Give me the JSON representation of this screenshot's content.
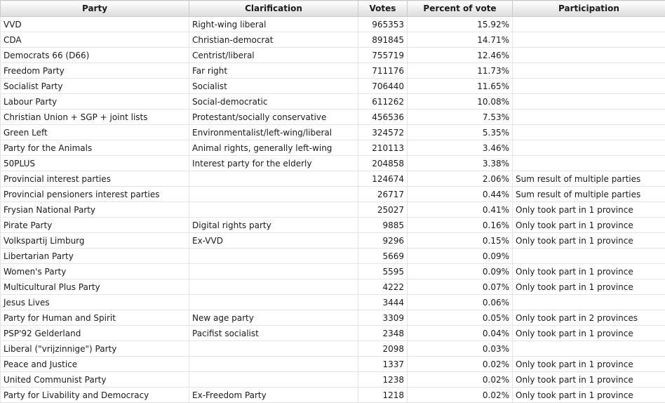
{
  "headers": [
    "Party",
    "Clarification",
    "Votes",
    "Percent of vote",
    "Participation"
  ],
  "rows": [
    [
      "VVD",
      "Right-wing liberal",
      "965353",
      "15.92%",
      ""
    ],
    [
      "CDA",
      "Christian-democrat",
      "891845",
      "14.71%",
      ""
    ],
    [
      "Democrats 66 (D66)",
      "Centrist/liberal",
      "755719",
      "12.46%",
      ""
    ],
    [
      "Freedom Party",
      "Far right",
      "711176",
      "11.73%",
      ""
    ],
    [
      "Socialist Party",
      "Socialist",
      "706440",
      "11.65%",
      ""
    ],
    [
      "Labour Party",
      "Social-democratic",
      "611262",
      "10.08%",
      ""
    ],
    [
      "Christian Union + SGP + joint lists",
      "Protestant/socially conservative",
      "456536",
      "7.53%",
      ""
    ],
    [
      "Green Left",
      "Environmentalist/left-wing/liberal",
      "324572",
      "5.35%",
      ""
    ],
    [
      "Party for the Animals",
      "Animal rights, generally left-wing",
      "210113",
      "3.46%",
      ""
    ],
    [
      "50PLUS",
      "Interest party for the elderly",
      "204858",
      "3.38%",
      ""
    ],
    [
      "Provincial interest parties",
      "",
      "124674",
      "2.06%",
      "Sum result of multiple parties"
    ],
    [
      "Provincial pensioners interest parties",
      "",
      "26717",
      "0.44%",
      "Sum result of multiple parties"
    ],
    [
      "Frysian National Party",
      "",
      "25027",
      "0.41%",
      "Only took part in 1 province"
    ],
    [
      "Pirate Party",
      "Digital rights party",
      "9885",
      "0.16%",
      "Only took part in 1 province"
    ],
    [
      "Volkspartij Limburg",
      "Ex-VVD",
      "9296",
      "0.15%",
      "Only took part in 1 province"
    ],
    [
      "Libertarian Party",
      "",
      "5669",
      "0.09%",
      ""
    ],
    [
      "Women's Party",
      "",
      "5595",
      "0.09%",
      "Only took part in 1 province"
    ],
    [
      "Multicultural Plus Party",
      "",
      "4222",
      "0.07%",
      "Only took part in 1 province"
    ],
    [
      "Jesus Lives",
      "",
      "3444",
      "0.06%",
      ""
    ],
    [
      "Party for Human and Spirit",
      "New age party",
      "3309",
      "0.05%",
      "Only took part in 2 provinces"
    ],
    [
      "PSP'92 Gelderland",
      "Pacifist socialist",
      "2348",
      "0.04%",
      "Only took part in 1 province"
    ],
    [
      "Liberal (\"vrijzinnige\") Party",
      "",
      "2098",
      "0.03%",
      ""
    ],
    [
      "Peace and Justice",
      "",
      "1337",
      "0.02%",
      "Only took part in 1 province"
    ],
    [
      "United Communist Party",
      "",
      "1238",
      "0.02%",
      "Only took part in 1 province"
    ],
    [
      "Party for Livability and Democracy",
      "Ex-Freedom Party",
      "1218",
      "0.02%",
      "Only took part in 1 province"
    ]
  ]
}
